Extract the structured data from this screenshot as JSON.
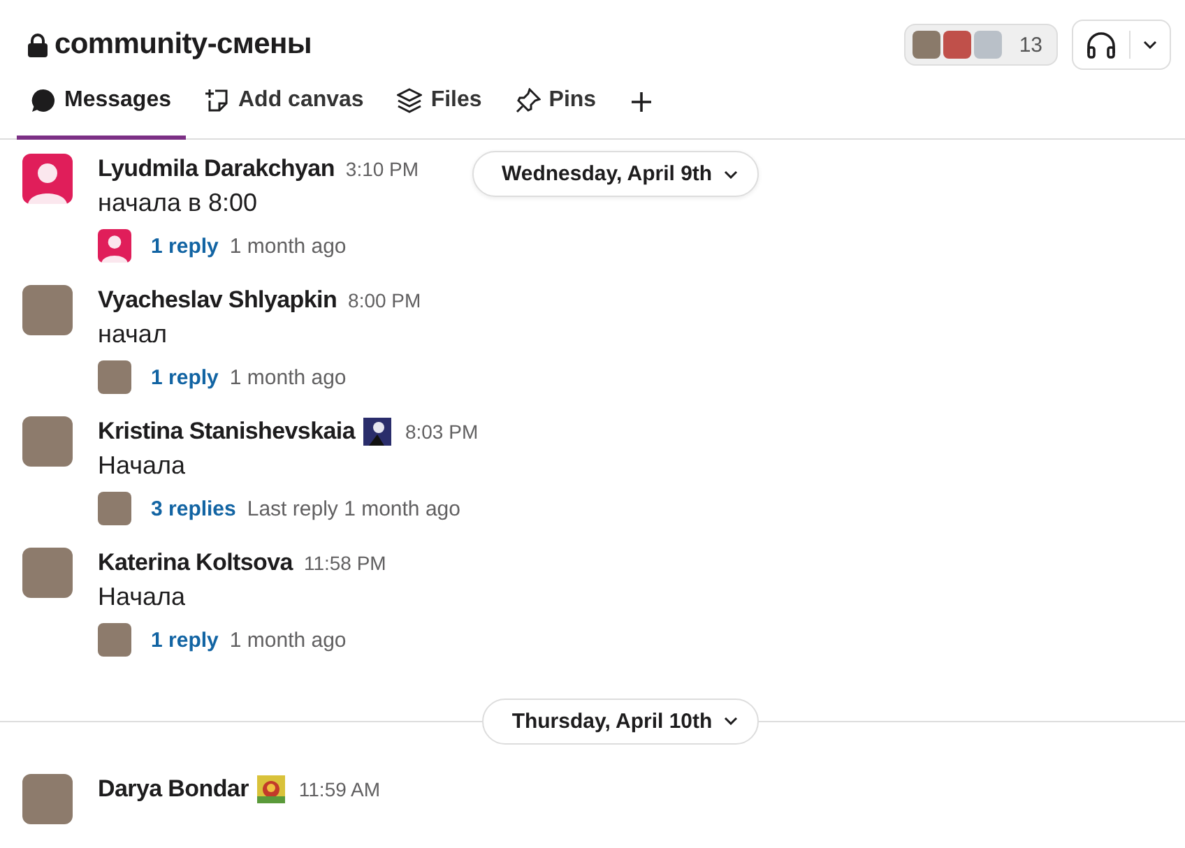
{
  "channel": {
    "title": "community-смены",
    "private": true
  },
  "members": {
    "count": "13"
  },
  "tabs": [
    {
      "label": "Messages",
      "selected": true
    },
    {
      "label": "Add canvas",
      "selected": false
    },
    {
      "label": "Files",
      "selected": false
    },
    {
      "label": "Pins",
      "selected": false
    }
  ],
  "sticky_date": "Wednesday, April 9th",
  "feed": [
    {
      "kind": "message",
      "author": "Lyudmila Darakchyan",
      "time": "3:10 PM",
      "default_avatar": true,
      "has_status": false,
      "text": "начала в 8:00",
      "reply_count": "1 reply",
      "reply_meta": "1 month ago"
    },
    {
      "kind": "message",
      "author": "Vyacheslav Shlyapkin",
      "time": "8:00 PM",
      "default_avatar": false,
      "has_status": false,
      "text": "начал",
      "reply_count": "1 reply",
      "reply_meta": "1 month ago"
    },
    {
      "kind": "message",
      "author": "Kristina Stanishevskaia",
      "time": "8:03 PM",
      "default_avatar": false,
      "has_status": true,
      "text": "Начала",
      "reply_count": "3 replies",
      "reply_meta": "Last reply 1 month ago"
    },
    {
      "kind": "message",
      "author": "Katerina Koltsova",
      "time": "11:58 PM",
      "default_avatar": false,
      "has_status": false,
      "text": "Начала",
      "reply_count": "1 reply",
      "reply_meta": "1 month ago"
    },
    {
      "kind": "divider",
      "label": "Thursday, April 10th"
    },
    {
      "kind": "message",
      "author": "Darya Bondar",
      "time": "11:59 AM",
      "default_avatar": false,
      "has_status": true
    }
  ]
}
